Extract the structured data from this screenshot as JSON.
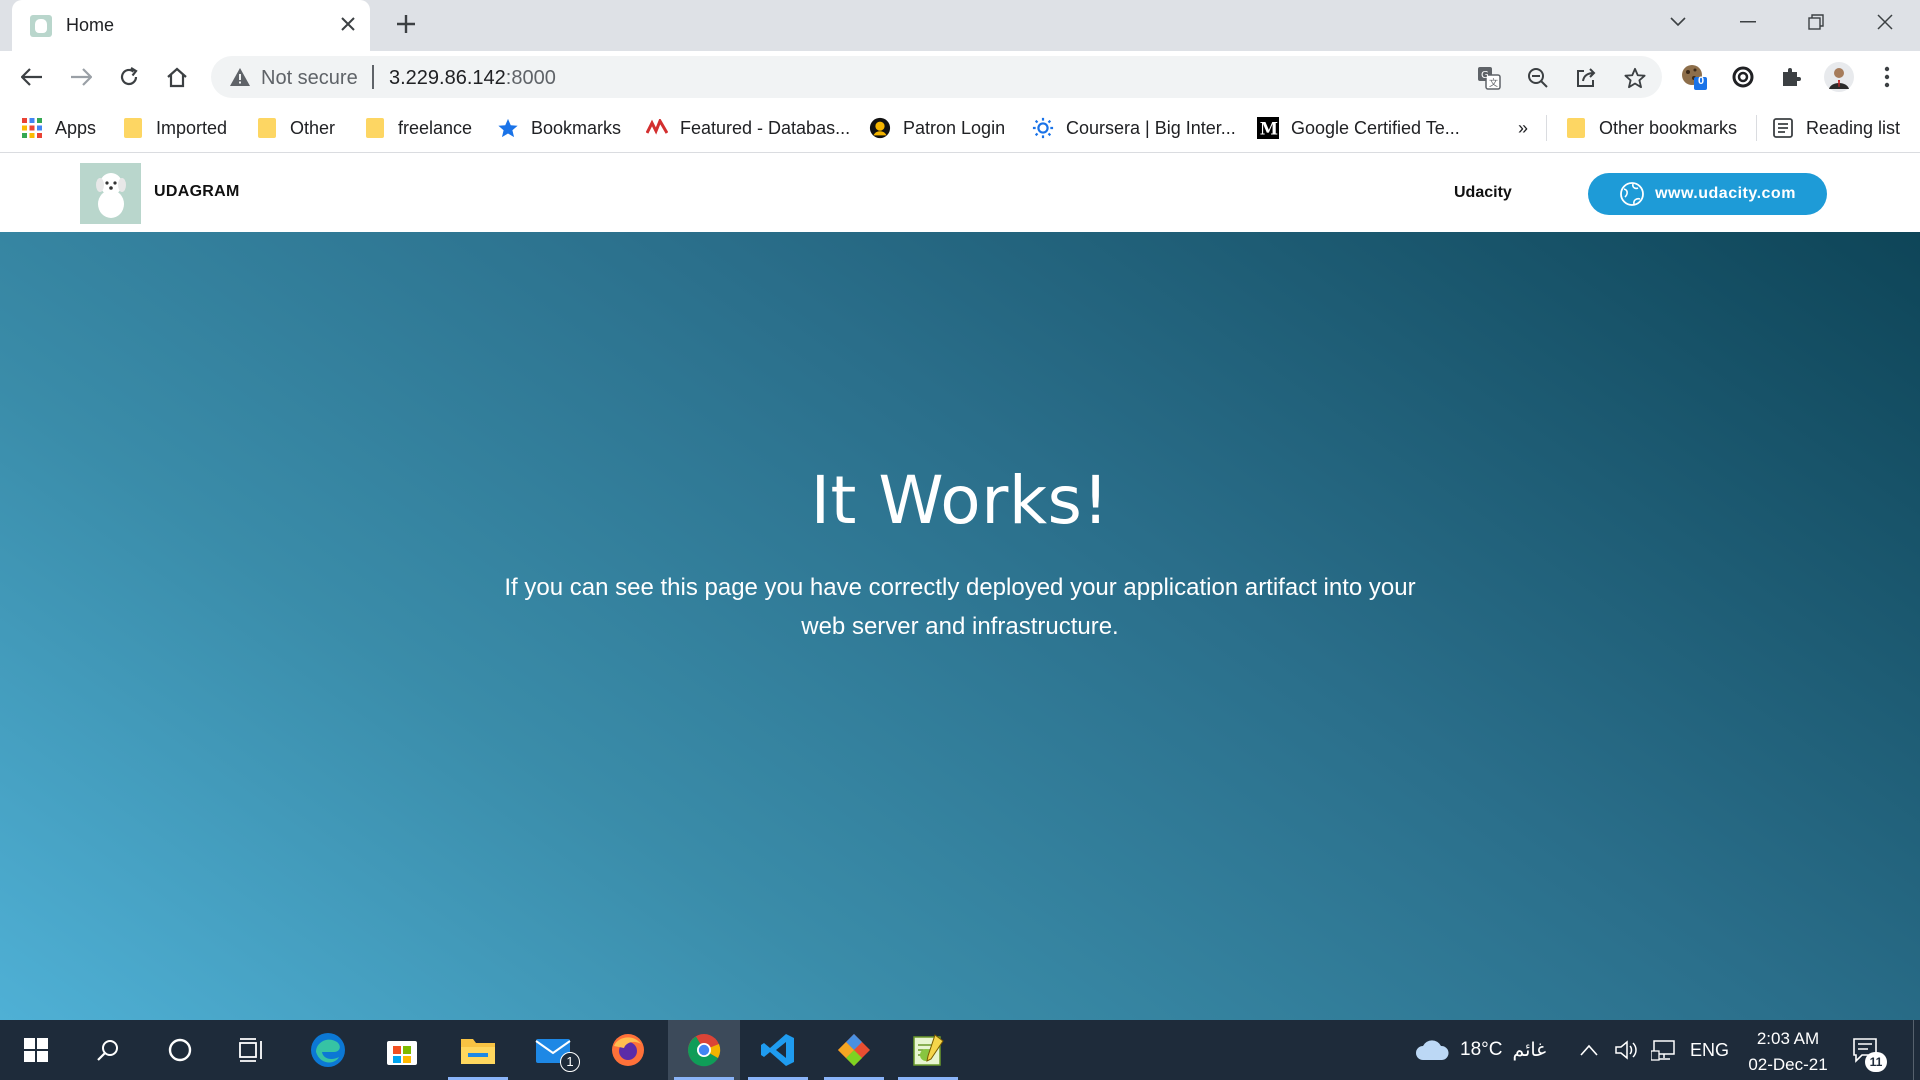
{
  "browser": {
    "tab": {
      "title": "Home"
    },
    "omnibox": {
      "security_label": "Not secure",
      "url_host": "3.229.86.142",
      "url_port": ":8000"
    },
    "extension_badge": "0",
    "bookmarks": [
      {
        "label": "Apps",
        "icon": "apps-grid-icon"
      },
      {
        "label": "Imported",
        "icon": "folder-icon"
      },
      {
        "label": "Other",
        "icon": "folder-icon"
      },
      {
        "label": "freelance",
        "icon": "folder-icon"
      },
      {
        "label": "Bookmarks",
        "icon": "star-icon"
      },
      {
        "label": "Featured - Databas...",
        "icon": "database-icon"
      },
      {
        "label": "Patron Login",
        "icon": "patron-icon"
      },
      {
        "label": "Coursera | Big Inter...",
        "icon": "coursera-icon"
      },
      {
        "label": "Google Certified Te...",
        "icon": "medium-icon"
      }
    ],
    "overflow": "»",
    "other_bookmarks": "Other bookmarks",
    "reading_list": "Reading list"
  },
  "page": {
    "brand": "UDAGRAM",
    "nav_link": "Udacity",
    "cta_label": "www.udacity.com",
    "hero_title": "It Works!",
    "hero_text": "If you can see this page you have correctly deployed your application artifact into your web server and infrastructure."
  },
  "taskbar": {
    "mail_badge": "1",
    "weather_temp": "18°C",
    "weather_desc": "غائم",
    "language": "ENG",
    "time": "2:03 AM",
    "date": "02-Dec-21",
    "notification_count": "11"
  },
  "colors": {
    "cta": "#1e9bd7",
    "hero_gradient_start": "#4fb0d5",
    "hero_gradient_end": "#0e4558",
    "taskbar": "#1e2b3a"
  }
}
